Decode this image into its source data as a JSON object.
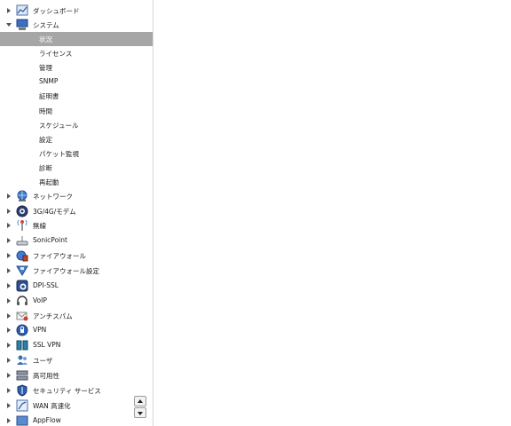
{
  "nav": {
    "items": [
      {
        "label": "ダッシュボード",
        "icon": "dashboard-chart-icon",
        "expanded": false
      },
      {
        "label": "システム",
        "icon": "monitor-icon",
        "expanded": true
      },
      {
        "label": "ネットワーク",
        "icon": "network-globe-icon",
        "expanded": false
      },
      {
        "label": "3G/4G/モデム",
        "icon": "modem-icon",
        "expanded": false
      },
      {
        "label": "無線",
        "icon": "wireless-antenna-icon",
        "expanded": false
      },
      {
        "label": "SonicPoint",
        "icon": "access-point-icon",
        "expanded": false
      },
      {
        "label": "ファイアウォール",
        "icon": "firewall-globe-icon",
        "expanded": false
      },
      {
        "label": "ファイアウォール設定",
        "icon": "firewall-settings-icon",
        "expanded": false
      },
      {
        "label": "DPI-SSL",
        "icon": "dpi-ssl-icon",
        "expanded": false
      },
      {
        "label": "VoIP",
        "icon": "voip-headset-icon",
        "expanded": false
      },
      {
        "label": "アンチスパム",
        "icon": "anti-spam-mail-icon",
        "expanded": false
      },
      {
        "label": "VPN",
        "icon": "vpn-lock-icon",
        "expanded": false
      },
      {
        "label": "SSL VPN",
        "icon": "ssl-vpn-icon",
        "expanded": false
      },
      {
        "label": "ユーザ",
        "icon": "users-icon",
        "expanded": false
      },
      {
        "label": "高可用性",
        "icon": "high-availability-icon",
        "expanded": false
      },
      {
        "label": "セキュリティ サービス",
        "icon": "security-shield-icon",
        "expanded": false
      },
      {
        "label": "WAN 高速化",
        "icon": "wan-acceleration-icon",
        "expanded": false
      },
      {
        "label": "AppFlow",
        "icon": "appflow-icon",
        "expanded": false
      }
    ],
    "system_children": [
      {
        "label": "状況",
        "selected": true
      },
      {
        "label": "ライセンス",
        "selected": false
      },
      {
        "label": "管理",
        "selected": false
      },
      {
        "label": "SNMP",
        "selected": false
      },
      {
        "label": "証明書",
        "selected": false
      },
      {
        "label": "時間",
        "selected": false
      },
      {
        "label": "スケジュール",
        "selected": false
      },
      {
        "label": "設定",
        "selected": false
      },
      {
        "label": "パケット監視",
        "selected": false
      },
      {
        "label": "診断",
        "selected": false
      },
      {
        "label": "再起動",
        "selected": false
      }
    ]
  },
  "colors": {
    "selected_bg": "#a6a6a6",
    "selected_text": "#ffffff",
    "text": "#1a1a1a"
  }
}
